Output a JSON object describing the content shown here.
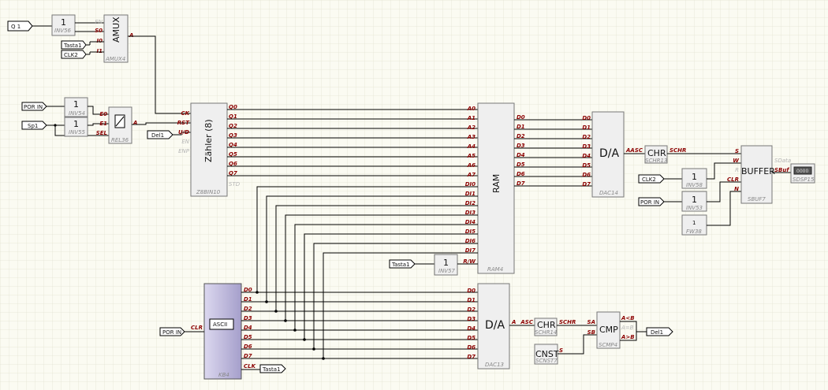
{
  "io_tags": {
    "q1": "Q 1",
    "tasta1_top": "Tasta1",
    "clk2_top": "CLK2",
    "por_in_1": "POR IN",
    "sp1": "Sp1",
    "del1_left": "Del1",
    "clk2_buf": "CLK2",
    "por_in_buf": "POR IN",
    "tasta1_ram": "Tasta1",
    "por_in_kb": "POR IN",
    "tasta1_kb": "Tasta1",
    "del1_cmp": "Del1"
  },
  "blocks": {
    "inv56": {
      "symbol": "1",
      "label": "INV56",
      "out_pin": "EN"
    },
    "amux": {
      "title": "AMUX",
      "label": "AMUX4",
      "pins": [
        "S0",
        "I0",
        "I1"
      ],
      "out": "A"
    },
    "inv54": {
      "symbol": "1",
      "label": "INV54"
    },
    "inv55": {
      "symbol": "1",
      "label": "INV55"
    },
    "rel": {
      "label": "REL36",
      "pins": [
        "E0",
        "E1",
        "SEL"
      ],
      "out": "A"
    },
    "counter": {
      "title": "Zähler (8)",
      "label": "Z8BIN10",
      "inputs": [
        "CK",
        "RST",
        "U/D",
        "EN",
        "ENP",
        "STD"
      ],
      "outputs": [
        "Q0",
        "Q1",
        "Q2",
        "Q3",
        "Q4",
        "Q5",
        "Q6",
        "Q7"
      ]
    },
    "ram": {
      "title": "RAM",
      "label": "RAM4",
      "addr": [
        "A0",
        "A1",
        "A2",
        "A3",
        "A4",
        "A5",
        "A6",
        "A7"
      ],
      "din": [
        "DI0",
        "DI1",
        "DI2",
        "DI3",
        "DI4",
        "DI5",
        "DI6",
        "DI7"
      ],
      "rw": "R/W",
      "dout": [
        "D0",
        "D1",
        "D2",
        "D3",
        "D4",
        "D5",
        "D6",
        "D7"
      ]
    },
    "dac14": {
      "title": "D/A",
      "label": "DAC14",
      "pins": [
        "D0",
        "D1",
        "D2",
        "D3",
        "D4",
        "D5",
        "D6",
        "D7"
      ],
      "out": "AASC"
    },
    "chr13": {
      "title": "CHR",
      "label": "SCHR13",
      "out": "SCHR"
    },
    "inv58": {
      "symbol": "1",
      "label": "INV58"
    },
    "inv53": {
      "symbol": "1",
      "label": "INV53"
    },
    "fw": {
      "symbol": "1",
      "label": "FW38"
    },
    "buffer": {
      "title": "BUFFER",
      "label": "SBUF7",
      "pins": [
        "S",
        "W",
        "R",
        "CLR",
        "N"
      ],
      "outs": [
        "SData",
        "SBuf S"
      ]
    },
    "sdsp": {
      "screen": "0000",
      "label": "SDSP15"
    },
    "inv57": {
      "symbol": "1",
      "label": "INV57"
    },
    "kb": {
      "title": "ASCII",
      "label": "KB4",
      "clr": "CLR",
      "outs": [
        "D0",
        "D1",
        "D2",
        "D3",
        "D4",
        "D5",
        "D6",
        "D7"
      ],
      "clk": "CLK"
    },
    "dac13": {
      "title": "D/A",
      "label": "DAC13",
      "pins": [
        "D0",
        "D1",
        "D2",
        "D3",
        "D4",
        "D5",
        "D6",
        "D7"
      ],
      "out": "A"
    },
    "chr14": {
      "title": "CHR",
      "label": "SCHR14",
      "in": "ASC",
      "out": "SCHR"
    },
    "cnst": {
      "title": "CNST",
      "label": "SCNST7",
      "out": "S"
    },
    "cmp": {
      "title": "CMP",
      "label": "SCMP4",
      "ins": [
        "SA",
        "SB"
      ],
      "outs": [
        "A<B",
        "A=B",
        "A>B"
      ]
    }
  },
  "colors": {
    "background": "#fbfbf2",
    "grid": "#e2e2d2",
    "wire": "#000000",
    "pin_text": "#8b0000",
    "kb_fill": "#bdb6d8"
  }
}
